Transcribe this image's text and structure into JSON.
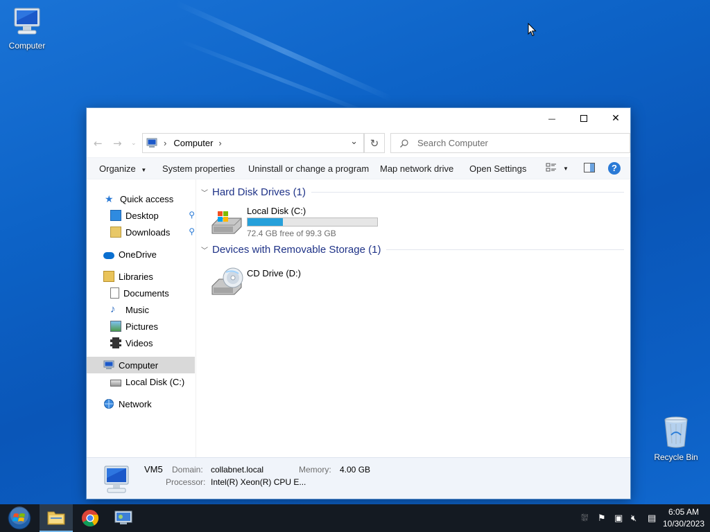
{
  "desktop": {
    "icons": [
      {
        "label": "Computer",
        "icon": "computer-icon"
      },
      {
        "label": "Recycle Bin",
        "icon": "recycle-bin-icon"
      }
    ]
  },
  "window": {
    "title_controls": {
      "minimize": "—",
      "maximize": "☐",
      "close": "✕"
    },
    "address": {
      "root_glyph": "›",
      "crumb": "Computer",
      "crumb_glyph": "›",
      "dropdown_glyph": "⌄",
      "refresh_glyph": "↻"
    },
    "search": {
      "placeholder": "Search Computer",
      "icon": "search-icon"
    },
    "commands": {
      "organize": "Organize",
      "system_properties": "System properties",
      "uninstall": "Uninstall or change a program",
      "map_drive": "Map network drive",
      "open_settings": "Open Settings",
      "help_glyph": "?"
    },
    "nav": {
      "quick_access": "Quick access",
      "desktop": "Desktop",
      "downloads": "Downloads",
      "onedrive": "OneDrive",
      "libraries": "Libraries",
      "documents": "Documents",
      "music": "Music",
      "pictures": "Pictures",
      "videos": "Videos",
      "computer": "Computer",
      "local_disk": "Local Disk (C:)",
      "network": "Network"
    },
    "groups": {
      "hard_disks": {
        "title": "Hard Disk Drives (1)"
      },
      "removable": {
        "title": "Devices with Removable Storage (1)"
      }
    },
    "drives": {
      "c": {
        "name": "Local Disk (C:)",
        "free_text": "72.4 GB free of 99.3 GB",
        "used_fraction": 0.271
      },
      "d": {
        "name": "CD Drive (D:)"
      }
    },
    "details": {
      "name": "VM5",
      "domain_label": "Domain:",
      "domain_value": "collabnet.local",
      "memory_label": "Memory:",
      "memory_value": "4.00 GB",
      "processor_label": "Processor:",
      "processor_value": "Intel(R) Xeon(R) CPU E..."
    }
  },
  "taskbar": {
    "pinned": [
      "start-button",
      "file-explorer",
      "chrome",
      "computer-management"
    ],
    "clock": {
      "time": "6:05 AM",
      "date": "10/30/2023"
    }
  },
  "colors": {
    "accent": "#26a0da",
    "group_header": "#1e3287",
    "help_badge": "#2a7ad6",
    "taskbar": "#141a22"
  }
}
